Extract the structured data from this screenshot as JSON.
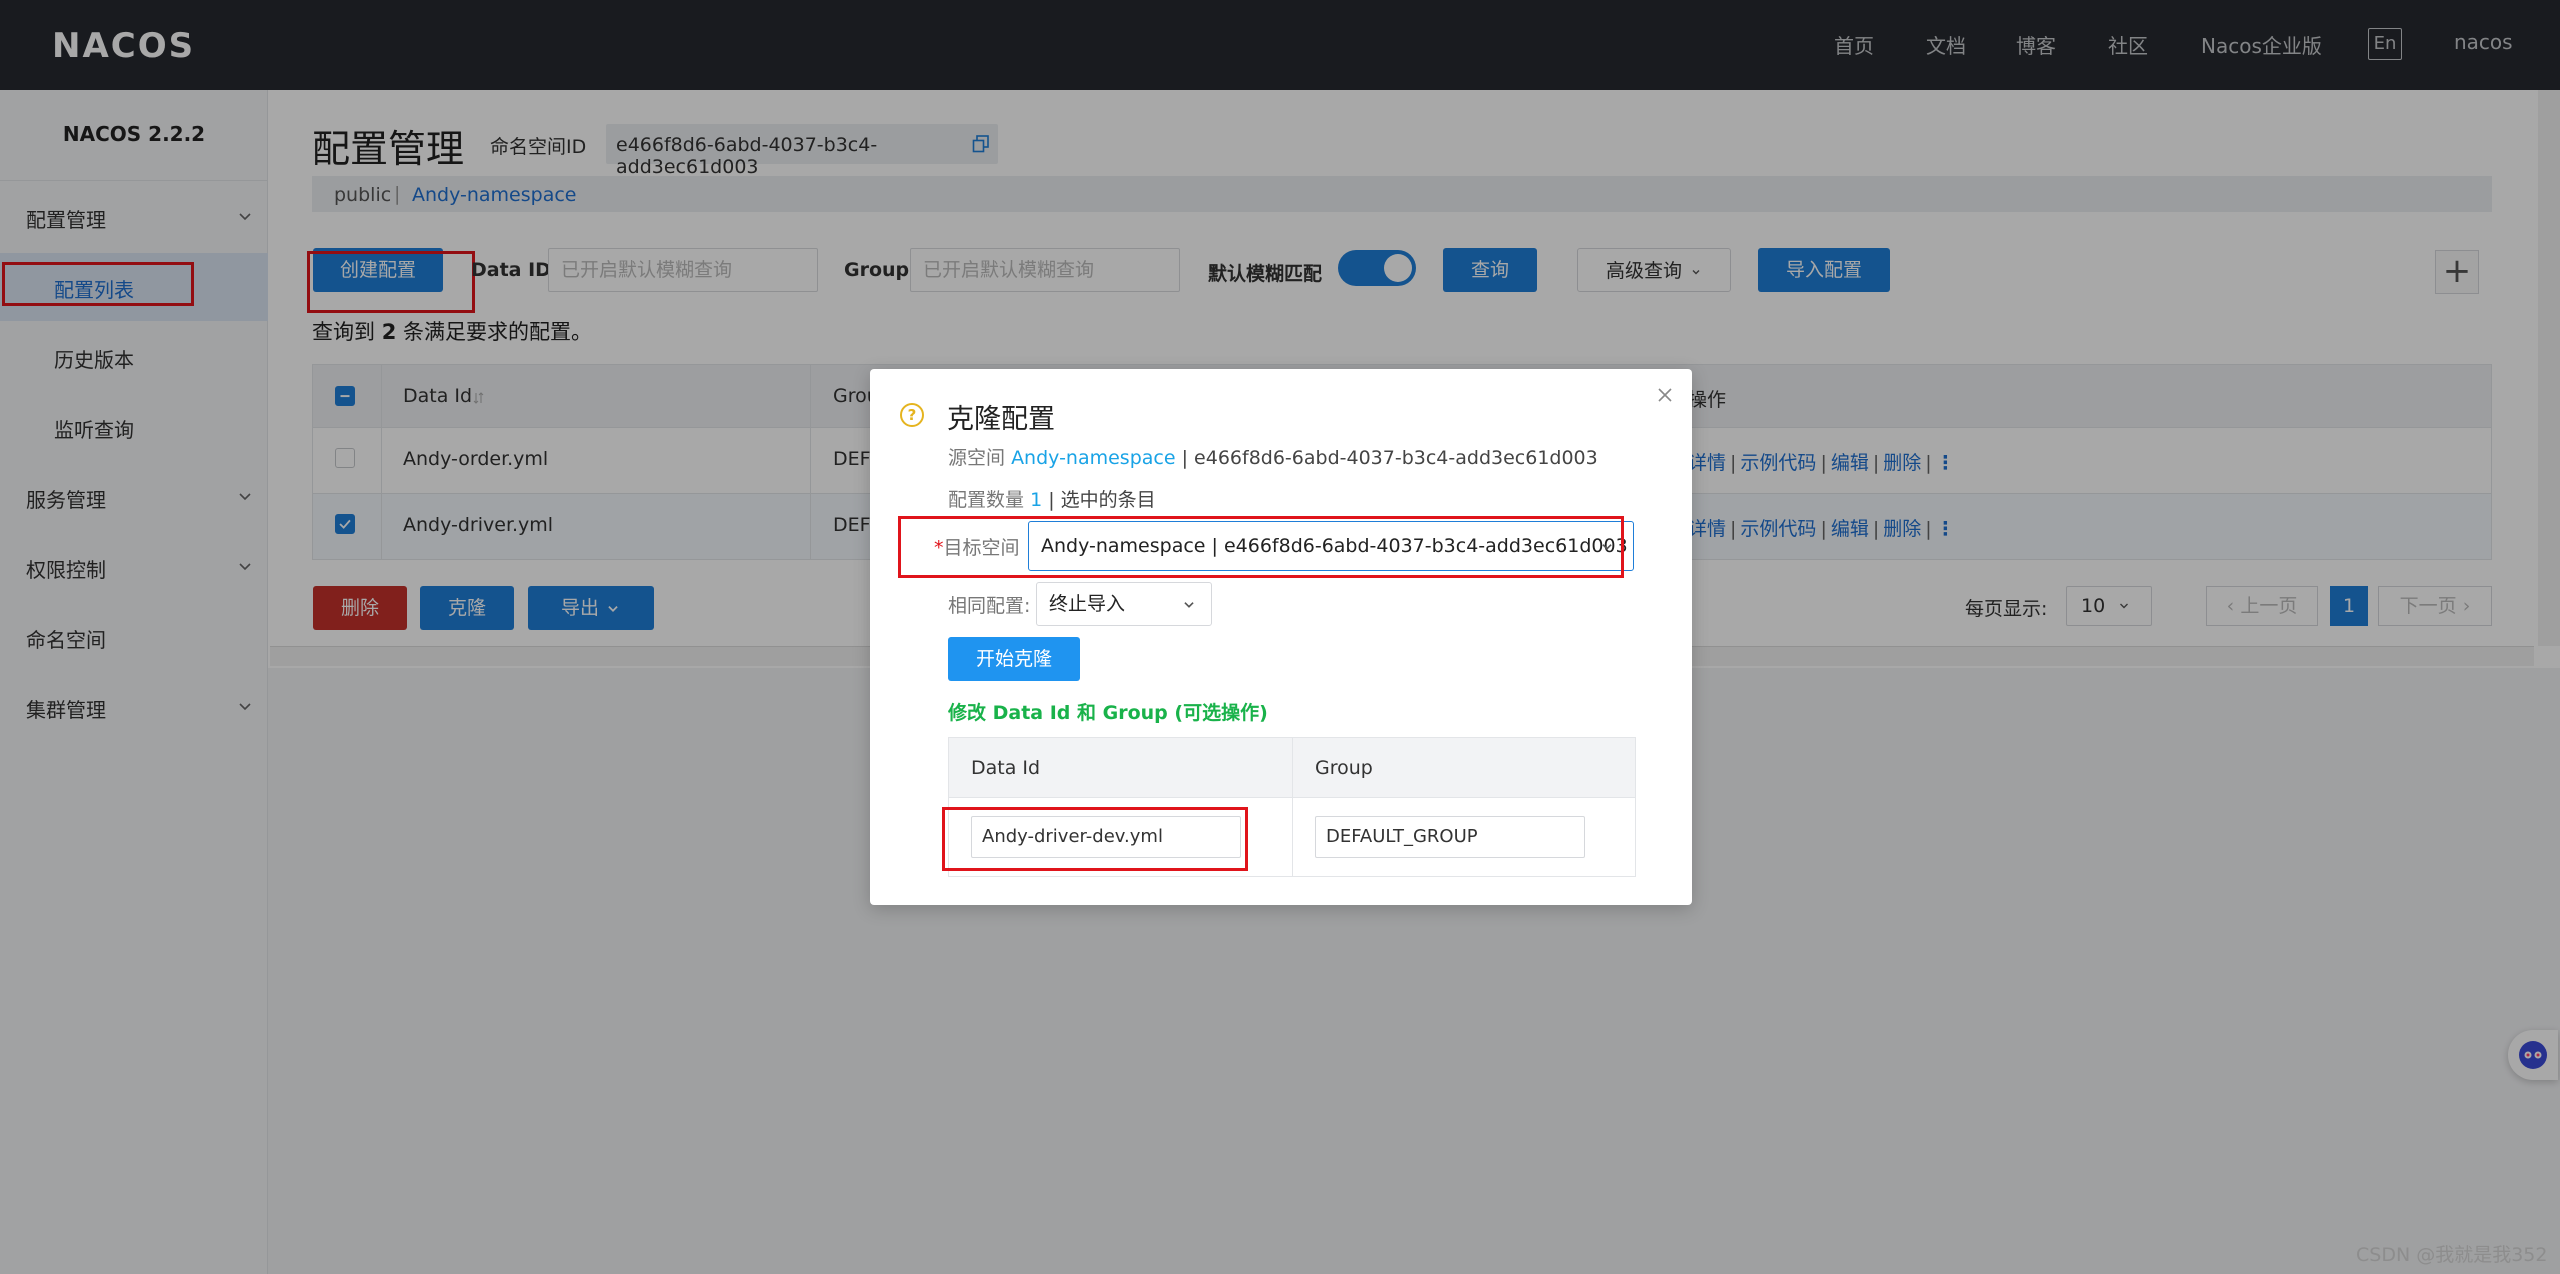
{
  "topbar": {
    "logo": "NACOS",
    "nav": [
      "首页",
      "文档",
      "博客",
      "社区",
      "Nacos企业版"
    ],
    "lang": "En",
    "user": "nacos"
  },
  "sidebar": {
    "version": "NACOS 2.2.2",
    "config_group": "配置管理",
    "config_list": "配置列表",
    "history": "历史版本",
    "listen_query": "监听查询",
    "service": "服务管理",
    "auth": "权限控制",
    "namespace": "命名空间",
    "cluster": "集群管理"
  },
  "page": {
    "title": "配置管理",
    "ns_label": "命名空间ID",
    "ns_id": "e466f8d6-6abd-4037-b3c4-add3ec61d003",
    "crumb_public": "public",
    "crumb_sep": "|",
    "crumb_ns": "Andy-namespace"
  },
  "toolbar": {
    "create": "创建配置",
    "dataid_label": "Data ID",
    "dataid_placeholder": "已开启默认模糊查询",
    "group_label": "Group",
    "group_placeholder": "已开启默认模糊查询",
    "fuzzy_label": "默认模糊匹配",
    "query": "查询",
    "advanced": "高级查询",
    "import": "导入配置",
    "plus": "+"
  },
  "result": {
    "prefix": "查询到",
    "count": "2",
    "suffix": "条满足要求的配置。"
  },
  "table": {
    "headers": {
      "dataid": "Data Id",
      "group": "Grou",
      "ops": "操作"
    },
    "rows": [
      {
        "dataid": "Andy-order.yml",
        "group": "DEF",
        "checked": false
      },
      {
        "dataid": "Andy-driver.yml",
        "group": "DEF",
        "checked": true
      }
    ],
    "ops": {
      "detail": "详情",
      "sample": "示例代码",
      "edit": "编辑",
      "delete": "删除",
      "sep": "|",
      "more": "⋮"
    }
  },
  "bottom": {
    "delete": "删除",
    "clone": "克隆",
    "export": "导出",
    "per_page_label": "每页显示:",
    "per_page": "10",
    "prev": "上一页",
    "page": "1",
    "next": "下一页"
  },
  "dialog": {
    "title": "克隆配置",
    "source_label": "源空间",
    "source_ns": "Andy-namespace",
    "source_id": "| e466f8d6-6abd-4037-b3c4-add3ec61d003",
    "count_label": "配置数量",
    "count": "1",
    "count_suffix": "| 选中的条目",
    "req_star": "*",
    "target_label": "目标空间",
    "target_value": "Andy-namespace | e466f8d6-6abd-4037-b3c4-add3ec61d003",
    "same_label": "相同配置:",
    "same_value": "终止导入",
    "start": "开始克隆",
    "modify_hint": "修改 Data Id 和 Group (可选操作)",
    "col_dataid": "Data Id",
    "col_group": "Group",
    "new_dataid": "Andy-driver-dev.yml",
    "new_group": "DEFAULT_GROUP"
  },
  "watermark": "CSDN @我就是我352",
  "colors": {
    "primary": "#1f7ed8",
    "danger": "#c4312b",
    "highlight": "#e0141b",
    "success": "#19b24a"
  }
}
